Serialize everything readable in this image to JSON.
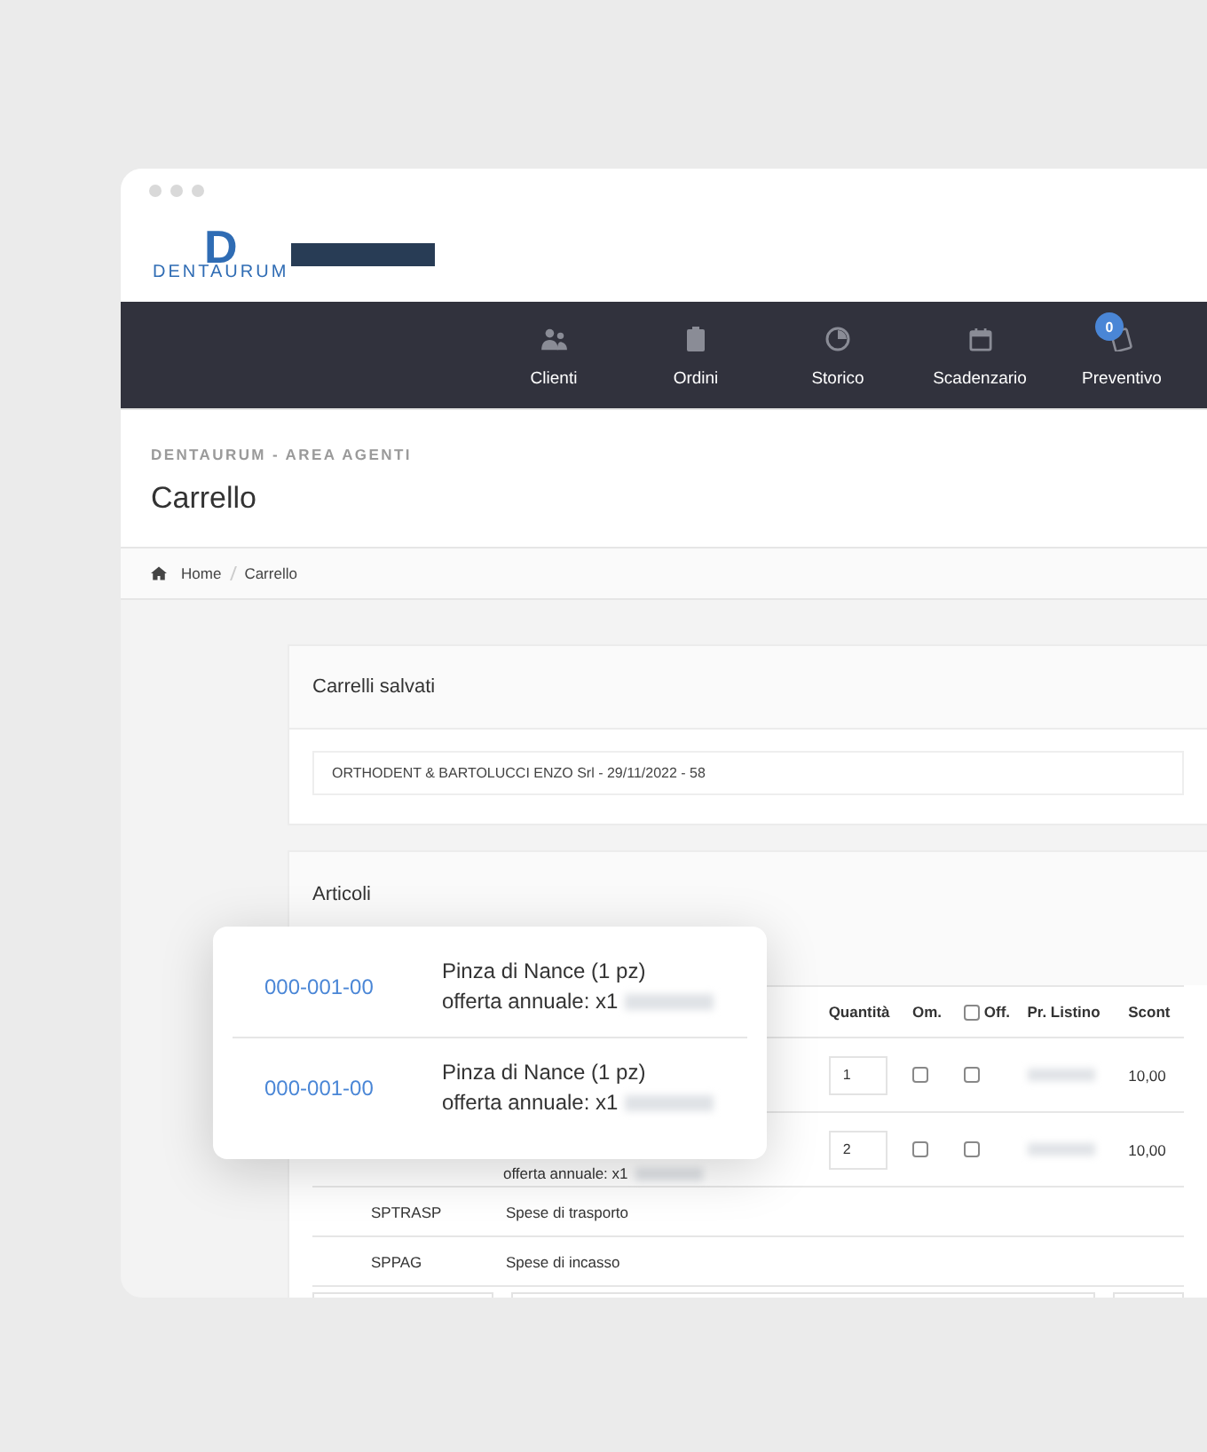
{
  "logo": {
    "letter": "D",
    "wordmark": "DENTAURUM"
  },
  "nav": [
    {
      "kind": "users",
      "label": "Clienti"
    },
    {
      "kind": "clipboard",
      "label": "Ordini"
    },
    {
      "kind": "pie",
      "label": "Storico"
    },
    {
      "kind": "calendar",
      "label": "Scadenzario"
    },
    {
      "kind": "quote",
      "label": "Preventivo",
      "badge": "0"
    }
  ],
  "header": {
    "eyebrow": "DENTAURUM - AREA AGENTI",
    "title": "Carrello"
  },
  "breadcrumb": [
    "Home",
    "Carrello"
  ],
  "saved_carts": {
    "title": "Carrelli salvati",
    "value": "ORTHODENT & BARTOLUCCI ENZO Srl - 29/11/2022 - 58"
  },
  "articles": {
    "title": "Articoli",
    "columns": [
      {
        "kind": "text",
        "label": "Quantità"
      },
      {
        "kind": "text",
        "label": "Om."
      },
      {
        "kind": "checkbox",
        "label": "Off.",
        "checked": false
      },
      {
        "kind": "text",
        "label": "Pr. Listino"
      },
      {
        "kind": "text",
        "label": "Scont"
      }
    ],
    "rows": [
      {
        "kind": "item",
        "quantity": "1",
        "om": false,
        "off": false,
        "discount": "10,00"
      },
      {
        "kind": "item",
        "description": "offerta annuale: x1",
        "quantity": "2",
        "om": false,
        "off": false,
        "discount": "10,00"
      },
      {
        "kind": "fee",
        "code": "SPTRASP",
        "description": "Spese di trasporto"
      },
      {
        "kind": "fee",
        "code": "SPPAG",
        "description": "Spese di incasso"
      }
    ]
  },
  "popup": [
    {
      "code": "000-001-00",
      "name": "Pinza di Nance (1 pz)",
      "offer": "offerta annuale: x1"
    },
    {
      "code": "000-001-00",
      "name": "Pinza di Nance (1 pz)",
      "offer": "offerta annuale: x1"
    }
  ]
}
